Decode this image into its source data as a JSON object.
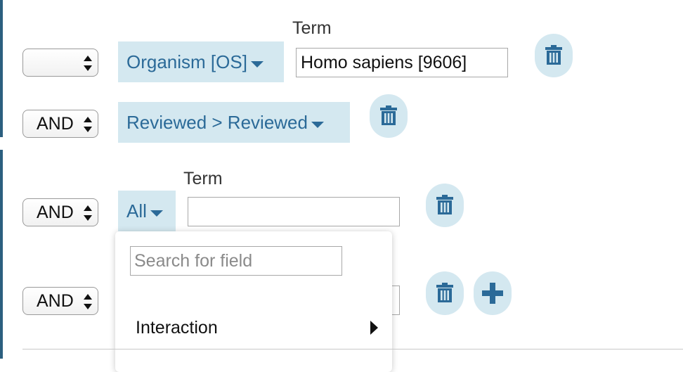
{
  "colors": {
    "field_bg": "#d4e8f0",
    "field_text": "#2b6a98",
    "icon_color": "#2b6a98",
    "sidebar_edge": "#2c5f7f"
  },
  "rows": [
    {
      "operator": "",
      "field": "Organism [OS]",
      "term_label": "Term",
      "term_value": "Homo sapiens [9606]",
      "actions": [
        "trash-icon"
      ]
    },
    {
      "operator": "AND",
      "field": "Reviewed > Reviewed",
      "actions": [
        "trash-icon"
      ]
    },
    {
      "operator": "AND",
      "field": "All",
      "term_label": "Term",
      "term_value": "",
      "actions": [
        "trash-icon"
      ]
    },
    {
      "operator": "AND",
      "actions": [
        "trash-icon",
        "plus-icon"
      ]
    }
  ],
  "field_dropdown": {
    "search_placeholder": "Search for field",
    "items": [
      {
        "label": "Interaction",
        "has_submenu": true
      }
    ]
  }
}
